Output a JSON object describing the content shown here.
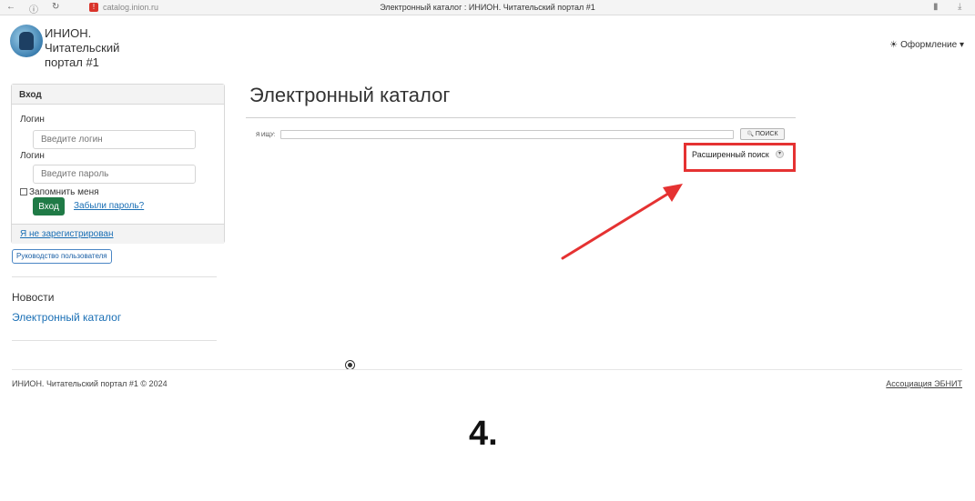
{
  "browser": {
    "url": "catalog.inion.ru",
    "tab_title": "Электронный каталог : ИНИОН. Читательский портал #1",
    "back_icon": "←",
    "info_icon": "ⓘ",
    "reload_icon": "↻",
    "warn_icon": "!",
    "bookmark_icon": "▮",
    "download_icon": "⤓"
  },
  "header": {
    "brand": "ИНИОН. Читательский портал #1",
    "theme_label": "Оформление",
    "theme_icon": "☀",
    "theme_caret": "▾"
  },
  "login": {
    "title": "Вход",
    "login_label": "Логин",
    "login_placeholder": "Введите логин",
    "password_label": "Логин",
    "password_placeholder": "Введите пароль",
    "remember": "Запомнить меня",
    "submit": "Вход",
    "forgot": "Забыли пароль?",
    "register": "Я не зарегистрирован"
  },
  "sidebar": {
    "guide_button": "Руководство пользователя",
    "news": "Новости",
    "catalog_link": "Электронный каталог"
  },
  "main": {
    "title": "Электронный каталог",
    "search_label": "Я ИЩУ:",
    "search_value": "",
    "search_button": "ПОИСК",
    "search_button_icon": "🔍",
    "advanced_search": "Расширенный поиск",
    "advanced_toggle": "▾"
  },
  "footer": {
    "copyright": "ИНИОН. Читательский портал #1 © 2024",
    "association": "Ассоциация ЭБНИТ"
  },
  "annotation": {
    "step": "4.",
    "highlight_color": "#e53232"
  }
}
